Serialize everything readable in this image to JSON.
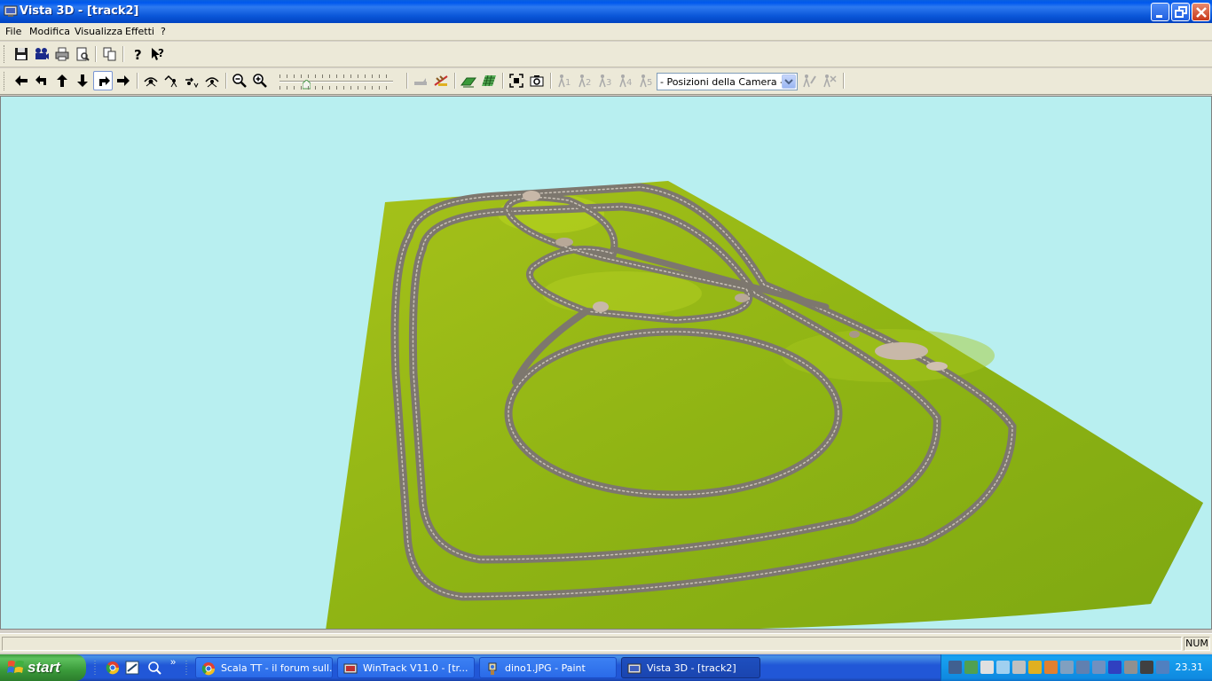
{
  "window": {
    "title": "Vista 3D - [track2]"
  },
  "menu": {
    "items": [
      "File",
      "Modifica",
      "Visualizza",
      "Effetti",
      "?"
    ]
  },
  "toolbar": {
    "camera_select_value": "- Posizioni della Camera -",
    "camera_positions": [
      "1",
      "2",
      "3",
      "4",
      "5"
    ]
  },
  "viewport": {
    "sky_color": "#b8eff0",
    "terrain_color": "#8db516",
    "edge_color": "#8a8a8a"
  },
  "statusbar": {
    "main_text": "",
    "num_indicator": "NUM"
  },
  "taskbar": {
    "start_label": "start",
    "tasks": [
      {
        "label": "Scala TT - il forum sull...",
        "active": false
      },
      {
        "label": "WinTrack  V11.0 - [tr...",
        "active": false
      },
      {
        "label": "dino1.JPG - Paint",
        "active": false
      },
      {
        "label": "Vista 3D - [track2]",
        "active": true
      }
    ],
    "clock": "23.31"
  }
}
